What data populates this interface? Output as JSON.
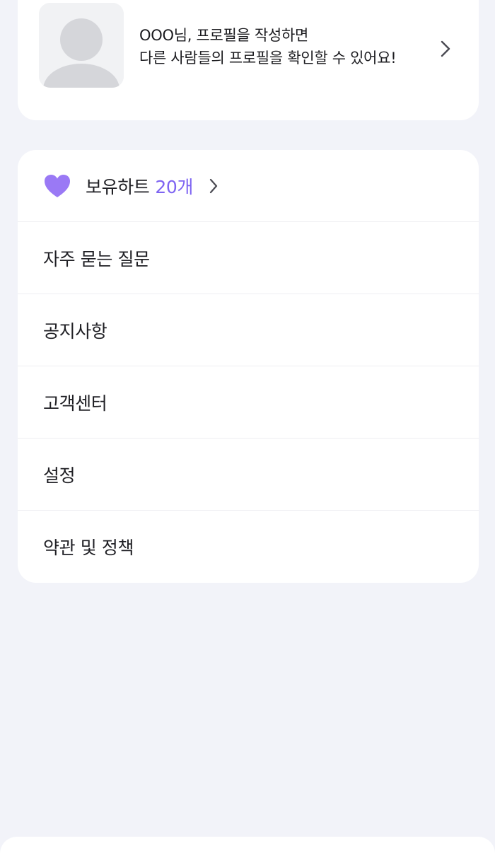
{
  "profile": {
    "prompt_line1": "OOO님, 프로필을 작성하면",
    "prompt_line2": "다른 사람들의 프로필을 확인할 수 있어요!",
    "avatar_icon": "default-avatar-icon",
    "chevron_icon": "chevron-right-icon"
  },
  "hearts": {
    "label": "보유하트",
    "count": "20개",
    "icon": "heart-icon",
    "accent_color": "#7E64F2",
    "heart_color": "#9A79F5"
  },
  "menu": {
    "items": [
      {
        "label": "자주 묻는 질문"
      },
      {
        "label": "공지사항"
      },
      {
        "label": "고객센터"
      },
      {
        "label": "설정"
      },
      {
        "label": "약관 및 정책"
      }
    ]
  },
  "colors": {
    "background": "#F2F3F9",
    "card": "#FFFFFF",
    "divider": "#EEEEF2",
    "text": "#1F1F24"
  }
}
